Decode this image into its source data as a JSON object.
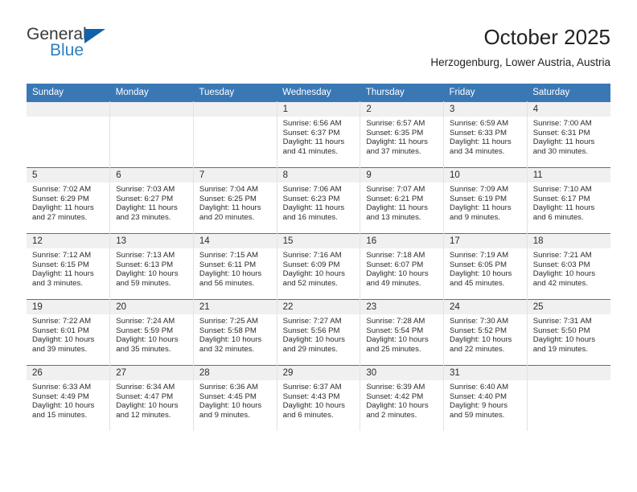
{
  "brand": {
    "name_part1": "General",
    "name_part2": "Blue",
    "logo_icon": "triangle-logo-icon"
  },
  "header": {
    "month_title": "October 2025",
    "location": "Herzogenburg, Lower Austria, Austria"
  },
  "colors": {
    "header_blue": "#3a78b5",
    "brand_blue": "#2e7fc1",
    "logo_blue": "#1162ab",
    "daynum_bar": "#f0f0f0",
    "cell_border": "#e2e2e2"
  },
  "calendar": {
    "weekday_headers": [
      "Sunday",
      "Monday",
      "Tuesday",
      "Wednesday",
      "Thursday",
      "Friday",
      "Saturday"
    ],
    "weeks": [
      [
        {
          "day": "",
          "lines": []
        },
        {
          "day": "",
          "lines": []
        },
        {
          "day": "",
          "lines": []
        },
        {
          "day": "1",
          "lines": [
            "Sunrise: 6:56 AM",
            "Sunset: 6:37 PM",
            "Daylight: 11 hours",
            "and 41 minutes."
          ]
        },
        {
          "day": "2",
          "lines": [
            "Sunrise: 6:57 AM",
            "Sunset: 6:35 PM",
            "Daylight: 11 hours",
            "and 37 minutes."
          ]
        },
        {
          "day": "3",
          "lines": [
            "Sunrise: 6:59 AM",
            "Sunset: 6:33 PM",
            "Daylight: 11 hours",
            "and 34 minutes."
          ]
        },
        {
          "day": "4",
          "lines": [
            "Sunrise: 7:00 AM",
            "Sunset: 6:31 PM",
            "Daylight: 11 hours",
            "and 30 minutes."
          ]
        }
      ],
      [
        {
          "day": "5",
          "lines": [
            "Sunrise: 7:02 AM",
            "Sunset: 6:29 PM",
            "Daylight: 11 hours",
            "and 27 minutes."
          ]
        },
        {
          "day": "6",
          "lines": [
            "Sunrise: 7:03 AM",
            "Sunset: 6:27 PM",
            "Daylight: 11 hours",
            "and 23 minutes."
          ]
        },
        {
          "day": "7",
          "lines": [
            "Sunrise: 7:04 AM",
            "Sunset: 6:25 PM",
            "Daylight: 11 hours",
            "and 20 minutes."
          ]
        },
        {
          "day": "8",
          "lines": [
            "Sunrise: 7:06 AM",
            "Sunset: 6:23 PM",
            "Daylight: 11 hours",
            "and 16 minutes."
          ]
        },
        {
          "day": "9",
          "lines": [
            "Sunrise: 7:07 AM",
            "Sunset: 6:21 PM",
            "Daylight: 11 hours",
            "and 13 minutes."
          ]
        },
        {
          "day": "10",
          "lines": [
            "Sunrise: 7:09 AM",
            "Sunset: 6:19 PM",
            "Daylight: 11 hours",
            "and 9 minutes."
          ]
        },
        {
          "day": "11",
          "lines": [
            "Sunrise: 7:10 AM",
            "Sunset: 6:17 PM",
            "Daylight: 11 hours",
            "and 6 minutes."
          ]
        }
      ],
      [
        {
          "day": "12",
          "lines": [
            "Sunrise: 7:12 AM",
            "Sunset: 6:15 PM",
            "Daylight: 11 hours",
            "and 3 minutes."
          ]
        },
        {
          "day": "13",
          "lines": [
            "Sunrise: 7:13 AM",
            "Sunset: 6:13 PM",
            "Daylight: 10 hours",
            "and 59 minutes."
          ]
        },
        {
          "day": "14",
          "lines": [
            "Sunrise: 7:15 AM",
            "Sunset: 6:11 PM",
            "Daylight: 10 hours",
            "and 56 minutes."
          ]
        },
        {
          "day": "15",
          "lines": [
            "Sunrise: 7:16 AM",
            "Sunset: 6:09 PM",
            "Daylight: 10 hours",
            "and 52 minutes."
          ]
        },
        {
          "day": "16",
          "lines": [
            "Sunrise: 7:18 AM",
            "Sunset: 6:07 PM",
            "Daylight: 10 hours",
            "and 49 minutes."
          ]
        },
        {
          "day": "17",
          "lines": [
            "Sunrise: 7:19 AM",
            "Sunset: 6:05 PM",
            "Daylight: 10 hours",
            "and 45 minutes."
          ]
        },
        {
          "day": "18",
          "lines": [
            "Sunrise: 7:21 AM",
            "Sunset: 6:03 PM",
            "Daylight: 10 hours",
            "and 42 minutes."
          ]
        }
      ],
      [
        {
          "day": "19",
          "lines": [
            "Sunrise: 7:22 AM",
            "Sunset: 6:01 PM",
            "Daylight: 10 hours",
            "and 39 minutes."
          ]
        },
        {
          "day": "20",
          "lines": [
            "Sunrise: 7:24 AM",
            "Sunset: 5:59 PM",
            "Daylight: 10 hours",
            "and 35 minutes."
          ]
        },
        {
          "day": "21",
          "lines": [
            "Sunrise: 7:25 AM",
            "Sunset: 5:58 PM",
            "Daylight: 10 hours",
            "and 32 minutes."
          ]
        },
        {
          "day": "22",
          "lines": [
            "Sunrise: 7:27 AM",
            "Sunset: 5:56 PM",
            "Daylight: 10 hours",
            "and 29 minutes."
          ]
        },
        {
          "day": "23",
          "lines": [
            "Sunrise: 7:28 AM",
            "Sunset: 5:54 PM",
            "Daylight: 10 hours",
            "and 25 minutes."
          ]
        },
        {
          "day": "24",
          "lines": [
            "Sunrise: 7:30 AM",
            "Sunset: 5:52 PM",
            "Daylight: 10 hours",
            "and 22 minutes."
          ]
        },
        {
          "day": "25",
          "lines": [
            "Sunrise: 7:31 AM",
            "Sunset: 5:50 PM",
            "Daylight: 10 hours",
            "and 19 minutes."
          ]
        }
      ],
      [
        {
          "day": "26",
          "lines": [
            "Sunrise: 6:33 AM",
            "Sunset: 4:49 PM",
            "Daylight: 10 hours",
            "and 15 minutes."
          ]
        },
        {
          "day": "27",
          "lines": [
            "Sunrise: 6:34 AM",
            "Sunset: 4:47 PM",
            "Daylight: 10 hours",
            "and 12 minutes."
          ]
        },
        {
          "day": "28",
          "lines": [
            "Sunrise: 6:36 AM",
            "Sunset: 4:45 PM",
            "Daylight: 10 hours",
            "and 9 minutes."
          ]
        },
        {
          "day": "29",
          "lines": [
            "Sunrise: 6:37 AM",
            "Sunset: 4:43 PM",
            "Daylight: 10 hours",
            "and 6 minutes."
          ]
        },
        {
          "day": "30",
          "lines": [
            "Sunrise: 6:39 AM",
            "Sunset: 4:42 PM",
            "Daylight: 10 hours",
            "and 2 minutes."
          ]
        },
        {
          "day": "31",
          "lines": [
            "Sunrise: 6:40 AM",
            "Sunset: 4:40 PM",
            "Daylight: 9 hours",
            "and 59 minutes."
          ]
        },
        {
          "day": "",
          "lines": []
        }
      ]
    ]
  }
}
